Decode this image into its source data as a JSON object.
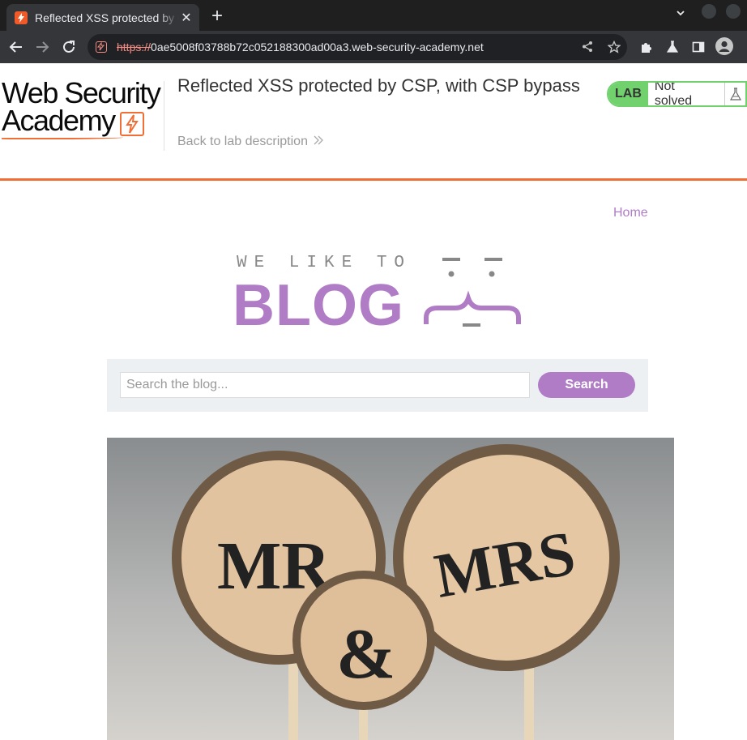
{
  "browser": {
    "tab_title": "Reflected XSS protected by CSP, with CSP bypass",
    "url_scheme": "https://",
    "url_host": "0ae5008f03788b72c052188300ad00a3.web-security-academy.net",
    "new_tab": "+",
    "tab_close": "✕"
  },
  "academy": {
    "logo_line1": "Web Security",
    "logo_line2": "Academy",
    "lab_title": "Reflected XSS protected by CSP, with CSP bypass",
    "back_link": "Back to lab description",
    "lab_label": "LAB",
    "lab_status": "Not solved",
    "accent_color": "#f06f36",
    "status_color": "#70d16d"
  },
  "blog": {
    "nav_home": "Home",
    "tagline": "WE LIKE TO",
    "wordmark": "BLOG",
    "search_placeholder": "Search the blog...",
    "search_button": "Search",
    "brand_color": "#b07cc6",
    "post_image": {
      "sign_left": "MR",
      "sign_middle": "&",
      "sign_right": "MRS"
    }
  }
}
